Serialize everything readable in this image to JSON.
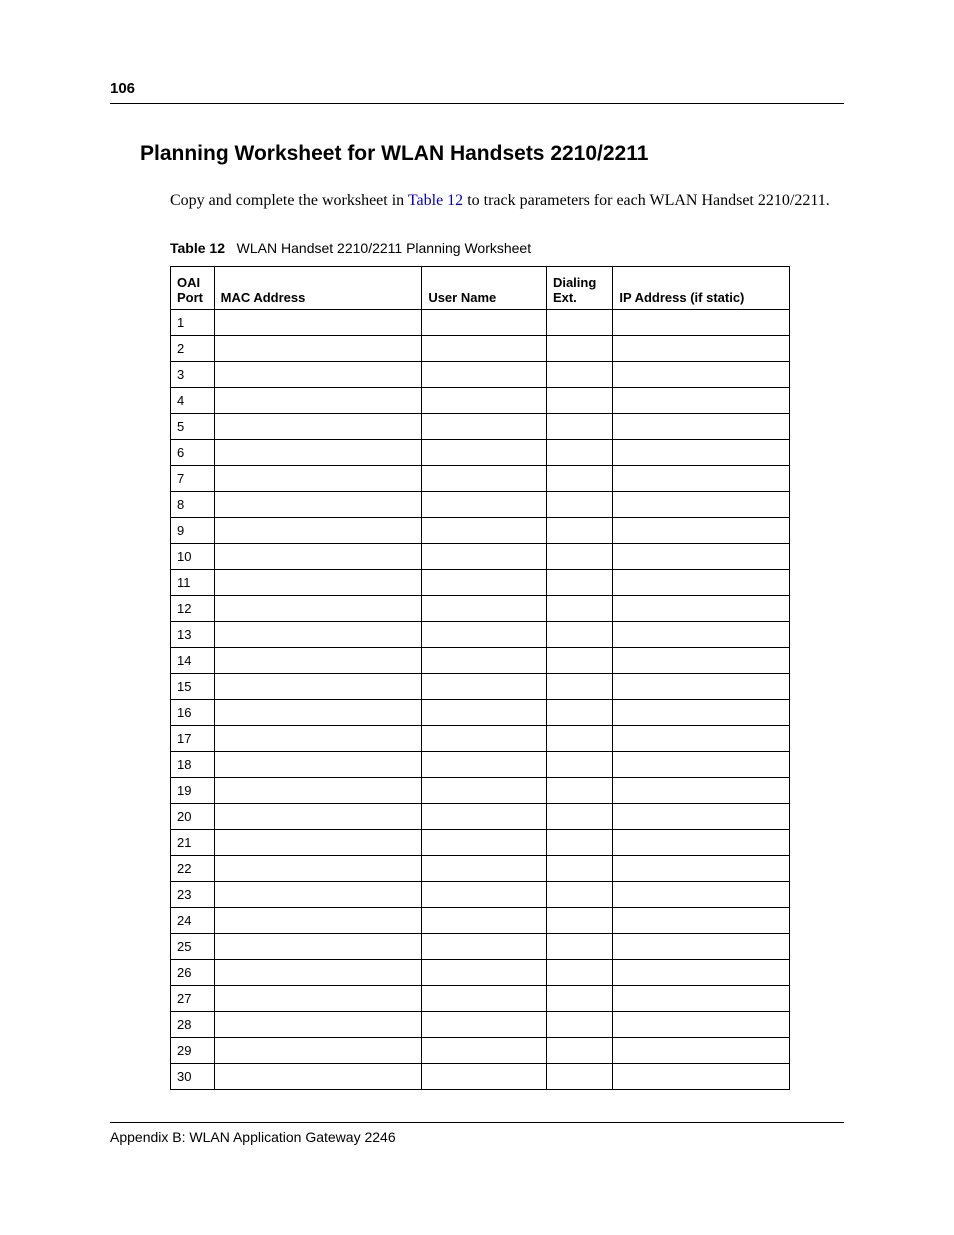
{
  "page_number": "106",
  "heading": "Planning Worksheet for WLAN Handsets 2210/2211",
  "intro": {
    "pre": "Copy and complete the worksheet in ",
    "link": "Table 12",
    "post": " to track parameters for each WLAN Handset 2210/2211."
  },
  "table_caption": {
    "label": "Table 12",
    "title": "WLAN Handset 2210/2211 Planning Worksheet"
  },
  "table": {
    "headers": {
      "col1": "OAI Port",
      "col2": "MAC Address",
      "col3": "User Name",
      "col4": "Dialing Ext.",
      "col5": "IP Address (if static)"
    },
    "rows": [
      {
        "port": "1",
        "mac": "",
        "user": "",
        "ext": "",
        "ip": ""
      },
      {
        "port": "2",
        "mac": "",
        "user": "",
        "ext": "",
        "ip": ""
      },
      {
        "port": "3",
        "mac": "",
        "user": "",
        "ext": "",
        "ip": ""
      },
      {
        "port": "4",
        "mac": "",
        "user": "",
        "ext": "",
        "ip": ""
      },
      {
        "port": "5",
        "mac": "",
        "user": "",
        "ext": "",
        "ip": ""
      },
      {
        "port": "6",
        "mac": "",
        "user": "",
        "ext": "",
        "ip": ""
      },
      {
        "port": "7",
        "mac": "",
        "user": "",
        "ext": "",
        "ip": ""
      },
      {
        "port": "8",
        "mac": "",
        "user": "",
        "ext": "",
        "ip": ""
      },
      {
        "port": "9",
        "mac": "",
        "user": "",
        "ext": "",
        "ip": ""
      },
      {
        "port": "10",
        "mac": "",
        "user": "",
        "ext": "",
        "ip": ""
      },
      {
        "port": "11",
        "mac": "",
        "user": "",
        "ext": "",
        "ip": ""
      },
      {
        "port": "12",
        "mac": "",
        "user": "",
        "ext": "",
        "ip": ""
      },
      {
        "port": "13",
        "mac": "",
        "user": "",
        "ext": "",
        "ip": ""
      },
      {
        "port": "14",
        "mac": "",
        "user": "",
        "ext": "",
        "ip": ""
      },
      {
        "port": "15",
        "mac": "",
        "user": "",
        "ext": "",
        "ip": ""
      },
      {
        "port": "16",
        "mac": "",
        "user": "",
        "ext": "",
        "ip": ""
      },
      {
        "port": "17",
        "mac": "",
        "user": "",
        "ext": "",
        "ip": ""
      },
      {
        "port": "18",
        "mac": "",
        "user": "",
        "ext": "",
        "ip": ""
      },
      {
        "port": "19",
        "mac": "",
        "user": "",
        "ext": "",
        "ip": ""
      },
      {
        "port": "20",
        "mac": "",
        "user": "",
        "ext": "",
        "ip": ""
      },
      {
        "port": "21",
        "mac": "",
        "user": "",
        "ext": "",
        "ip": ""
      },
      {
        "port": "22",
        "mac": "",
        "user": "",
        "ext": "",
        "ip": ""
      },
      {
        "port": "23",
        "mac": "",
        "user": "",
        "ext": "",
        "ip": ""
      },
      {
        "port": "24",
        "mac": "",
        "user": "",
        "ext": "",
        "ip": ""
      },
      {
        "port": "25",
        "mac": "",
        "user": "",
        "ext": "",
        "ip": ""
      },
      {
        "port": "26",
        "mac": "",
        "user": "",
        "ext": "",
        "ip": ""
      },
      {
        "port": "27",
        "mac": "",
        "user": "",
        "ext": "",
        "ip": ""
      },
      {
        "port": "28",
        "mac": "",
        "user": "",
        "ext": "",
        "ip": ""
      },
      {
        "port": "29",
        "mac": "",
        "user": "",
        "ext": "",
        "ip": ""
      },
      {
        "port": "30",
        "mac": "",
        "user": "",
        "ext": "",
        "ip": ""
      }
    ]
  },
  "footer": "Appendix B: WLAN Application Gateway 2246"
}
